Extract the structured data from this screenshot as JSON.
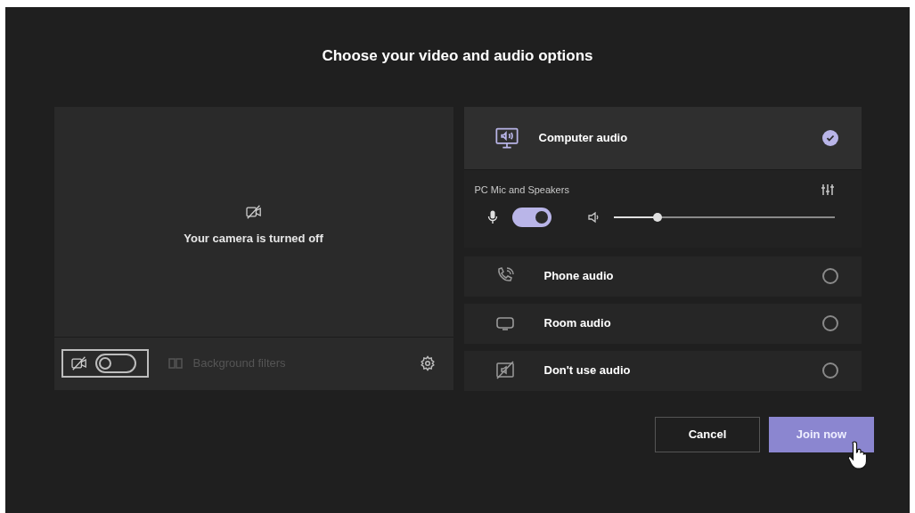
{
  "title": "Choose your video and audio options",
  "camera": {
    "message": "Your camera is turned off",
    "camera_on": false,
    "background_filters": {
      "label": "Background filters",
      "disabled": true
    }
  },
  "audio_options": [
    {
      "kind": "computer",
      "label": "Computer audio",
      "selected": true,
      "device": {
        "label": "PC Mic and Speakers",
        "mic_on": true,
        "volume": {
          "level": 0.2
        }
      }
    },
    {
      "kind": "phone",
      "label": "Phone audio",
      "selected": false
    },
    {
      "kind": "room",
      "label": "Room audio",
      "selected": false
    },
    {
      "kind": "none",
      "label": "Don't use audio",
      "selected": false
    }
  ],
  "buttons": [
    {
      "kind": "secondary",
      "label": "Cancel"
    },
    {
      "kind": "primary",
      "label": "Join now"
    }
  ]
}
